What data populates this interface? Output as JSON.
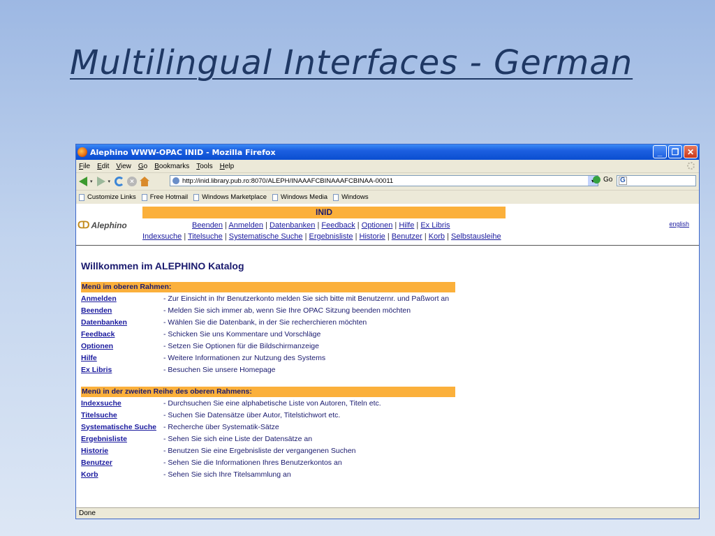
{
  "slide": {
    "title": "Multilingual Interfaces - German"
  },
  "window": {
    "title": "Alephino WWW-OPAC INID - Mozilla Firefox"
  },
  "menubar": [
    "File",
    "Edit",
    "View",
    "Go",
    "Bookmarks",
    "Tools",
    "Help"
  ],
  "navbar": {
    "url": "http://inid.library.pub.ro:8070/ALEPH/INAAAFCBINAAAFCBINAA-00011",
    "go_label": "Go"
  },
  "bookmarks": [
    "Customize Links",
    "Free Hotmail",
    "Windows Marketplace",
    "Windows Media",
    "Windows"
  ],
  "page": {
    "logo": "Alephino",
    "banner": "INID",
    "english_link": "english",
    "nav1": [
      "Beenden",
      "Anmelden",
      "Datenbanken",
      "Feedback",
      "Optionen",
      "Hilfe",
      "Ex Libris"
    ],
    "nav2": [
      "Indexsuche",
      "Titelsuche",
      "Systematische Suche",
      "Ergebnisliste",
      "Historie",
      "Benutzer",
      "Korb",
      "Selbstausleihe"
    ],
    "welcome": "Willkommen im ALEPHINO Katalog",
    "section1": {
      "heading": "Menü im oberen Rahmen:",
      "rows": [
        {
          "link": "Anmelden",
          "desc": "- Zur Einsicht in Ihr Benutzerkonto melden Sie sich bitte mit Benutzernr. und Paßwort an"
        },
        {
          "link": "Beenden",
          "desc": "- Melden Sie sich immer ab, wenn Sie Ihre OPAC Sitzung beenden möchten"
        },
        {
          "link": "Datenbanken",
          "desc": "- Wählen Sie die Datenbank, in der Sie recherchieren möchten"
        },
        {
          "link": "Feedback",
          "desc": "- Schicken Sie uns Kommentare und Vorschläge"
        },
        {
          "link": "Optionen",
          "desc": "- Setzen Sie Optionen für die Bildschirmanzeige"
        },
        {
          "link": "Hilfe",
          "desc": "- Weitere Informationen zur Nutzung des Systems"
        },
        {
          "link": "Ex Libris",
          "desc": "- Besuchen Sie unsere Homepage"
        }
      ]
    },
    "section2": {
      "heading": "Menü in der zweiten Reihe des oberen Rahmens:",
      "rows": [
        {
          "link": "Indexsuche",
          "desc": "- Durchsuchen Sie eine alphabetische Liste von Autoren, Titeln etc."
        },
        {
          "link": "Titelsuche",
          "desc": "- Suchen Sie Datensätze über Autor, Titelstichwort etc."
        },
        {
          "link": "Systematische Suche",
          "desc": "- Recherche über Systematik-Sätze"
        },
        {
          "link": "Ergebnisliste",
          "desc": "- Sehen Sie sich eine Liste der Datensätze an"
        },
        {
          "link": "Historie",
          "desc": "- Benutzen Sie eine Ergebnisliste der vergangenen Suchen"
        },
        {
          "link": "Benutzer",
          "desc": "- Sehen Sie die Informationen Ihres Benutzerkontos an"
        },
        {
          "link": "Korb",
          "desc": "- Sehen Sie sich Ihre Titelsammlung an"
        }
      ]
    }
  },
  "status": "Done"
}
